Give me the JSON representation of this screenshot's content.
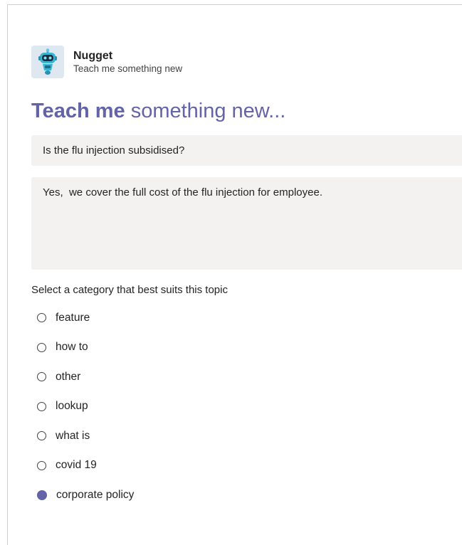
{
  "bot": {
    "name": "Nugget",
    "subtitle": "Teach me something new"
  },
  "title": {
    "bold": "Teach me",
    "rest": " something new..."
  },
  "question": {
    "value": "Is the flu injection subsidised?"
  },
  "answer": {
    "value": "Yes,  we cover the full cost of the flu injection for employee."
  },
  "category": {
    "prompt": "Select a category that best suits this topic",
    "options": [
      "feature",
      "how to",
      "other",
      "lookup",
      "what is",
      "covid 19",
      "corporate policy"
    ],
    "selected": "corporate policy"
  },
  "colors": {
    "accent": "#6264a7",
    "field_bg": "#f3f2f1"
  }
}
